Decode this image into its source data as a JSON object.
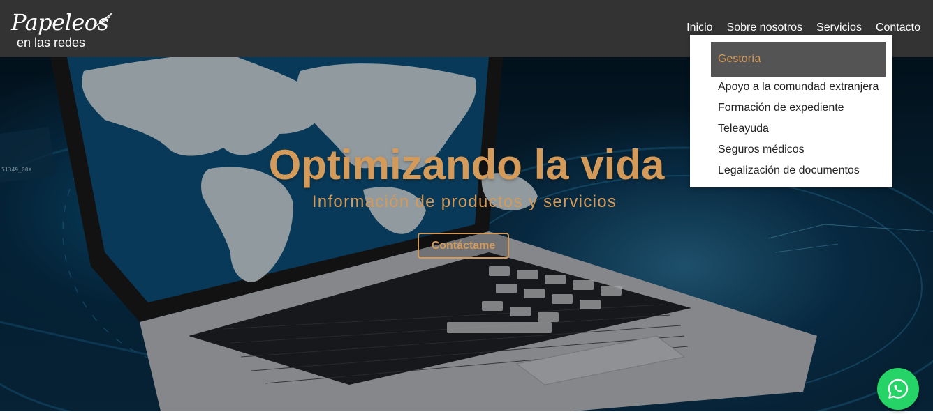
{
  "brand": {
    "logo_script": "Papeleos",
    "logo_sub": "en las redes"
  },
  "nav": {
    "items": [
      {
        "label": "Inicio"
      },
      {
        "label": "Sobre nosotros"
      },
      {
        "label": "Servicios"
      },
      {
        "label": "Contacto"
      }
    ]
  },
  "dropdown": {
    "active": "Gestoría",
    "items": [
      {
        "label": "Apoyo a la comundad extranjera"
      },
      {
        "label": "Formación de expediente"
      },
      {
        "label": "Teleayuda"
      },
      {
        "label": "Seguros médicos"
      },
      {
        "label": "Legalización de documentos"
      }
    ]
  },
  "hero": {
    "title": "Optimizando la vida",
    "subtitle": "Información de productos y servicios",
    "cta_label": "Contáctame",
    "screen_text": "51349_00X"
  },
  "colors": {
    "accent": "#d39a5a",
    "header_bg": "#333333",
    "dropdown_active_bg": "#545454",
    "whatsapp": "#25d366"
  },
  "icons": {
    "whatsapp": "whatsapp-icon",
    "logo_feather": "feather-icon"
  }
}
